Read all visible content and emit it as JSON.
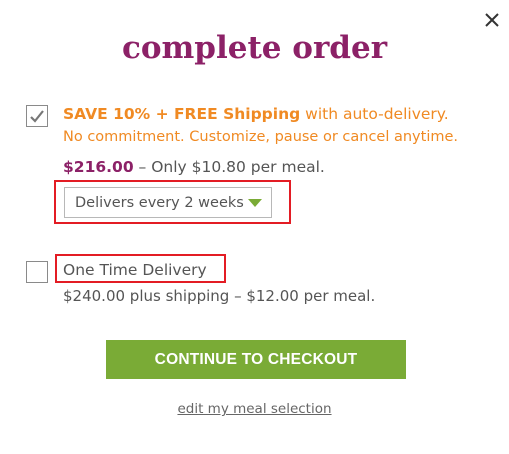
{
  "modal": {
    "title": "complete order",
    "close_icon": "close-icon"
  },
  "option_auto": {
    "checked": true,
    "headline_bold": "SAVE 10% + FREE Shipping",
    "headline_rest": " with auto-delivery.",
    "subtext": "No commitment. Customize, pause or cancel anytime.",
    "price": "$216.00",
    "price_detail": " – Only $10.80 per meal.",
    "frequency_selected": "Delivers every 2 weeks"
  },
  "option_once": {
    "checked": false,
    "label": "One Time Delivery",
    "description": "$240.00 plus shipping – $12.00 per meal."
  },
  "actions": {
    "continue_label": "CONTINUE TO CHECKOUT",
    "edit_link": "edit my meal selection"
  },
  "colors": {
    "brand_purple": "#8c2167",
    "accent_orange": "#f08a23",
    "cta_green": "#7aab36",
    "highlight_red": "#e31c24"
  }
}
